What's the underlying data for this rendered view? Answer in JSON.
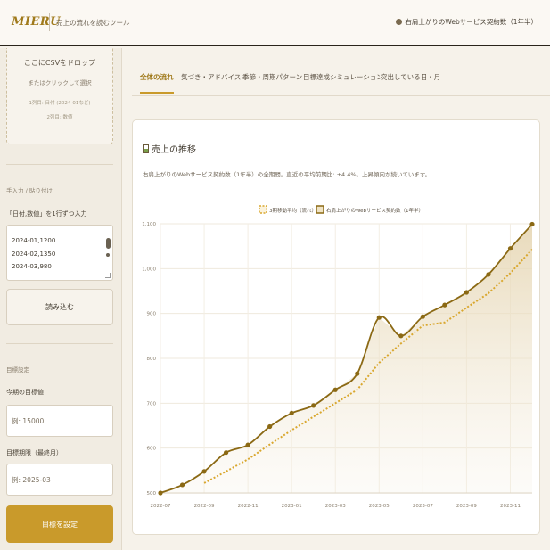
{
  "header": {
    "logo": "MIERU",
    "tagline": "売上の流れを読むツール",
    "dataset_label": "右肩上がりのWebサービス契約数（1年半）"
  },
  "sidebar": {
    "dropzone": {
      "title": "ここにCSVをドロップ",
      "subtitle": "またはクリックして選択",
      "hint1": "1列目: 日付 (2024-01など)",
      "hint2": "2列目: 数値"
    },
    "manual_section": "手入力 / 貼り付け",
    "manual_label": "「日付,数値」を1行ずつ入力",
    "manual_lines": [
      "2024-01,1200",
      "2024-02,1350",
      "2024-03,980"
    ],
    "load_button": "読み込む",
    "goal_section": "目標設定",
    "goal_value_label": "今期の目標値",
    "goal_value_placeholder": "例: 15000",
    "goal_deadline_label": "目標期限（最終月）",
    "goal_deadline_placeholder": "例: 2025-03",
    "goal_button": "目標を設定"
  },
  "tabs": [
    {
      "label": "全体の流れ",
      "active": true
    },
    {
      "label": "気づき・アドバイス",
      "active": false
    },
    {
      "label": "季節・周期パターン",
      "active": false
    },
    {
      "label": "目標達成シミュレーション",
      "active": false
    },
    {
      "label": "突出している日・月",
      "active": false
    }
  ],
  "card": {
    "title": "売上の推移",
    "description": "右肩上がりのWebサービス契約数（1年半）の全期間。直近の平均前期比: +4.4%。上昇傾向が続いています。"
  },
  "chart_data": {
    "type": "line",
    "legend_position": "top",
    "grid": true,
    "ylim": [
      500,
      1100
    ],
    "y_ticks": [
      "1,100",
      "1,000",
      "900",
      "800",
      "700",
      "600",
      "500"
    ],
    "x_ticks": [
      "2022-07",
      "2022-09",
      "2022-11",
      "2023-01",
      "2023-03",
      "2023-05",
      "2023-07",
      "2023-09",
      "2023-11"
    ],
    "x": [
      "2022-07",
      "2022-08",
      "2022-09",
      "2022-10",
      "2022-11",
      "2022-12",
      "2023-01",
      "2023-02",
      "2023-03",
      "2023-04",
      "2023-05",
      "2023-06",
      "2023-07",
      "2023-08",
      "2023-09",
      "2023-10",
      "2023-11",
      "2023-12"
    ],
    "series": [
      {
        "name": "3期移動平均（流れ）",
        "style": "dotted",
        "color": "#d9a72e",
        "values": [
          null,
          null,
          522,
          548,
          575,
          608,
          640,
          670,
          700,
          730,
          790,
          833,
          873,
          880,
          913,
          945,
          990,
          1043
        ]
      },
      {
        "name": "右肩上がりのWebサービス契約数（1年半）",
        "style": "solid",
        "color": "#8b6914",
        "values": [
          500,
          518,
          548,
          590,
          607,
          648,
          678,
          695,
          730,
          766,
          891,
          850,
          893,
          919,
          947,
          987,
          1045,
          1099
        ]
      }
    ]
  },
  "colors": {
    "accent": "#c99a2b",
    "line": "#8b6914",
    "moving_average": "#d9a72e"
  }
}
